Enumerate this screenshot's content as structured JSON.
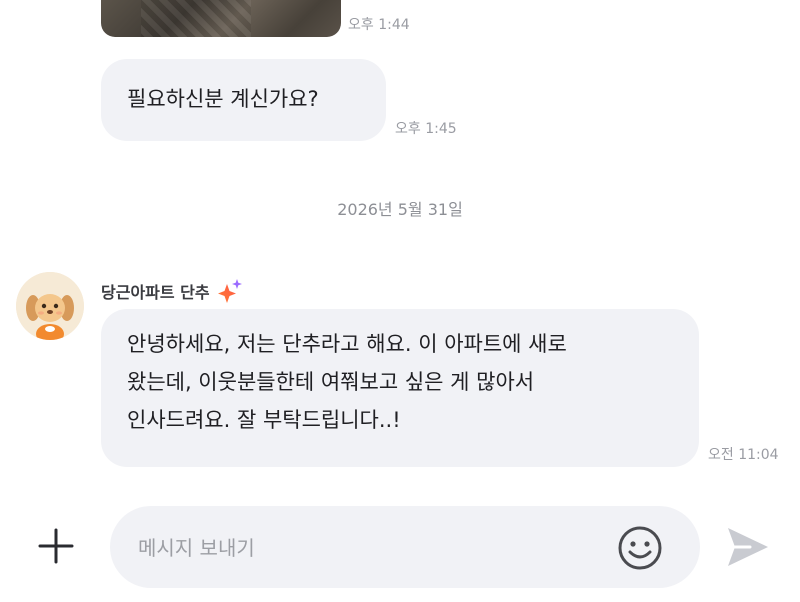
{
  "messages": [
    {
      "type": "image",
      "time": "오후 1:44"
    },
    {
      "type": "text",
      "text": "필요하신분 계신가요?",
      "time": "오후 1:45"
    }
  ],
  "date_separator": "2026년 5월 31일",
  "incoming": {
    "sender": "당근아파트 단추",
    "lines": [
      "안녕하세요, 저는 단추라고 해요. 이 아파트에 새로",
      "왔는데, 이웃분들한테 여쭤보고 싶은 게 많아서",
      "인사드려요. 잘 부탁드립니다..!"
    ],
    "time": "오전 11:04"
  },
  "composer": {
    "placeholder": "메시지 보내기",
    "plus_icon": "plus-icon",
    "emoji_icon": "smiley-icon",
    "send_icon": "send-icon"
  },
  "colors": {
    "bubble": "#f1f2f6",
    "timestamp": "#9a9ca3",
    "sparkle_orange": "#ff7a2f",
    "sparkle_purple": "#9b6bff"
  }
}
